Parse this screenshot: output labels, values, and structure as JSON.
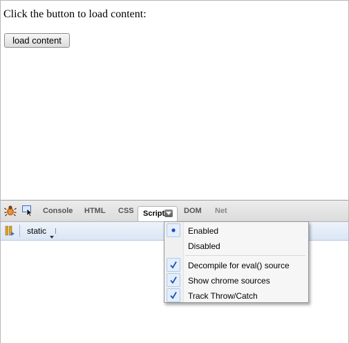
{
  "page": {
    "instruction_text": "Click the button to load content:",
    "load_button_label": "load content"
  },
  "firebug": {
    "tabs": [
      {
        "label": "Console"
      },
      {
        "label": "HTML"
      },
      {
        "label": "CSS"
      },
      {
        "label": "Script",
        "active": true
      },
      {
        "label": "DOM"
      },
      {
        "label": "Net"
      }
    ],
    "toolbar": {
      "script_selector": "static"
    },
    "script_menu": {
      "items": [
        {
          "label": "Enabled",
          "state": "radio-selected"
        },
        {
          "label": "Disabled",
          "state": "none"
        },
        {
          "label": "Decompile for eval() source",
          "state": "checked"
        },
        {
          "label": "Show chrome sources",
          "state": "checked"
        },
        {
          "label": "Track Throw/Catch",
          "state": "checked"
        }
      ]
    }
  },
  "icons": [
    "firebug-icon",
    "inspect-icon",
    "dropdown-arrow-icon",
    "pause-icon",
    "radio-dot-icon",
    "checkmark-icon"
  ],
  "colors": {
    "toolbar_blue": "#dae6f5",
    "check_blue": "#1c4fb5",
    "tabbar_gray": "#dcdcdc"
  }
}
